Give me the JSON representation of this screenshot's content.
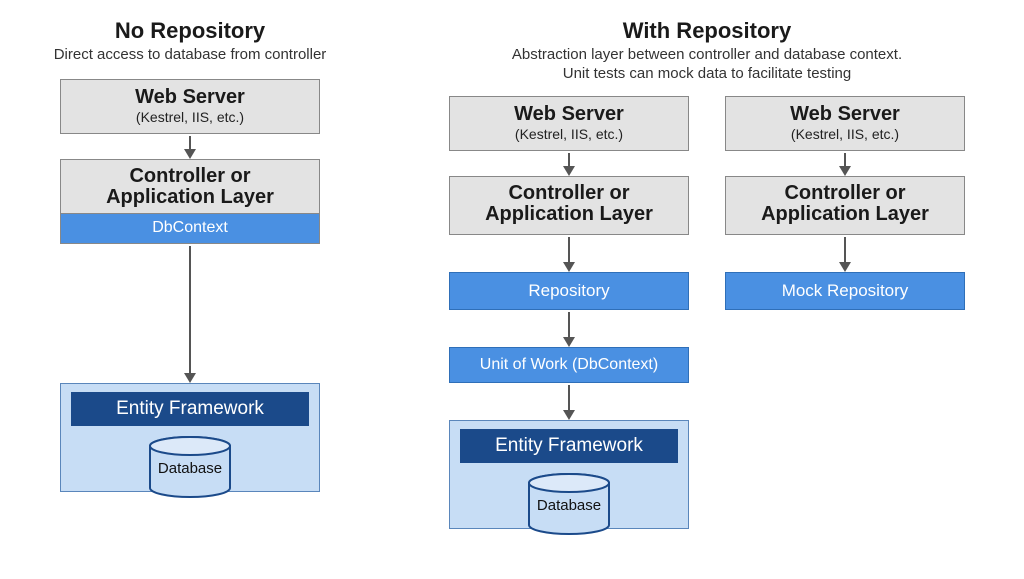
{
  "columns": {
    "no_repo": {
      "title": "No Repository",
      "subtitle": "Direct access to database from controller",
      "web_server_title": "Web Server",
      "web_server_sub": "(Kestrel, IIS, etc.)",
      "controller_line1": "Controller or",
      "controller_line2": "Application Layer",
      "dbcontext": "DbContext",
      "ef_title": "Entity Framework",
      "database": "Database"
    },
    "with_repo": {
      "title": "With Repository",
      "subtitle_line1": "Abstraction layer between controller and database context.",
      "subtitle_line2": "Unit tests can mock data to facilitate testing",
      "stack_a": {
        "web_server_title": "Web Server",
        "web_server_sub": "(Kestrel, IIS, etc.)",
        "controller_line1": "Controller or",
        "controller_line2": "Application Layer",
        "repository": "Repository",
        "uow": "Unit of Work (DbContext)",
        "ef_title": "Entity Framework",
        "database": "Database"
      },
      "stack_b": {
        "web_server_title": "Web Server",
        "web_server_sub": "(Kestrel, IIS, etc.)",
        "controller_line1": "Controller or",
        "controller_line2": "Application Layer",
        "mock_repository": "Mock Repository"
      }
    }
  },
  "colors": {
    "gray_box": "#e3e3e3",
    "blue_box": "#4a90e2",
    "ef_dark_blue": "#1b4a8a",
    "ef_panel": "#c7ddf5"
  }
}
